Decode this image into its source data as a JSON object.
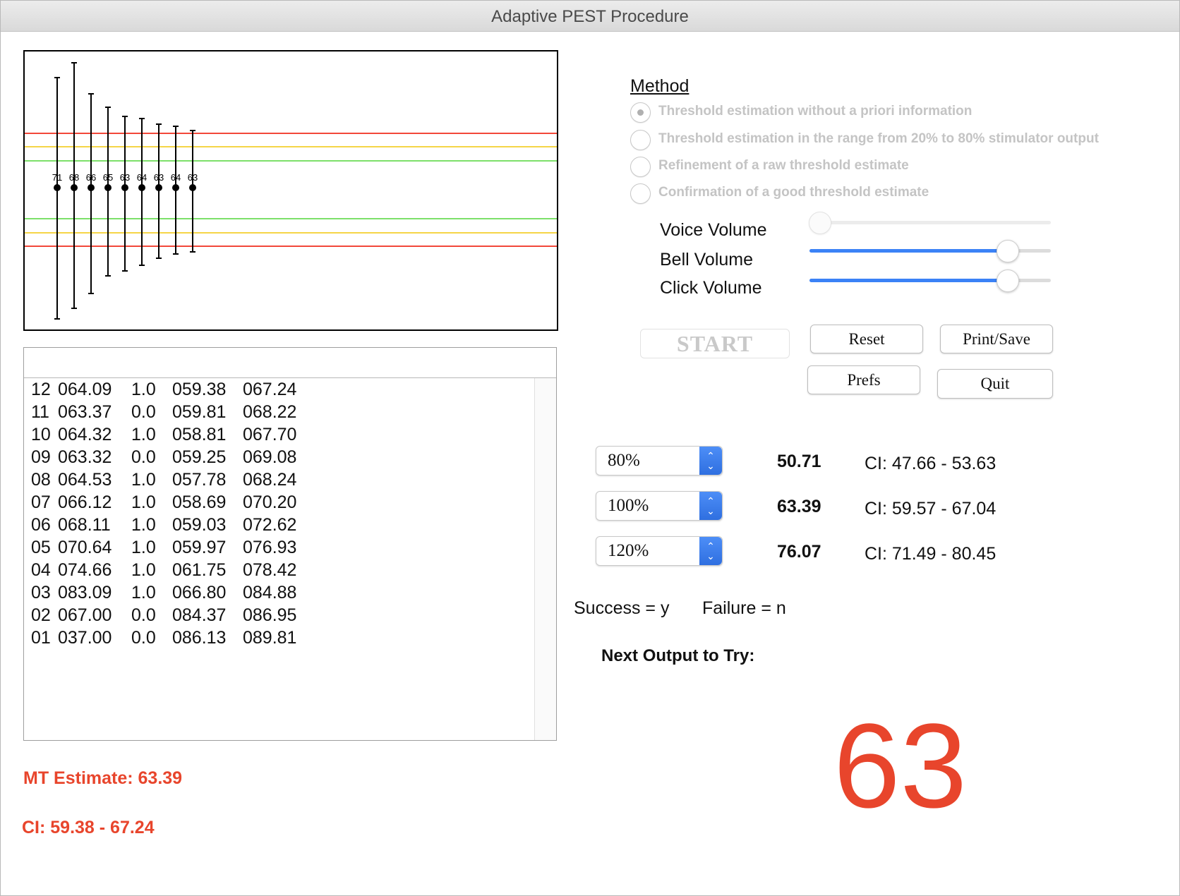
{
  "window": {
    "title": "Adaptive PEST Procedure"
  },
  "plot": {
    "center_labels": [
      "71",
      "68",
      "66",
      "65",
      "63",
      "64",
      "63",
      "64",
      "63"
    ],
    "line_colors": {
      "outer": "#f2483a",
      "middle": "#f5d547",
      "inner": "#7de06a"
    }
  },
  "log": {
    "rows": [
      [
        "12",
        "064.09",
        "1.0",
        "059.38",
        "067.24"
      ],
      [
        "11",
        "063.37",
        "0.0",
        "059.81",
        "068.22"
      ],
      [
        "10",
        "064.32",
        "1.0",
        "058.81",
        "067.70"
      ],
      [
        "09",
        "063.32",
        "0.0",
        "059.25",
        "069.08"
      ],
      [
        "08",
        "064.53",
        "1.0",
        "057.78",
        "068.24"
      ],
      [
        "07",
        "066.12",
        "1.0",
        "058.69",
        "070.20"
      ],
      [
        "06",
        "068.11",
        "1.0",
        "059.03",
        "072.62"
      ],
      [
        "05",
        "070.64",
        "1.0",
        "059.97",
        "076.93"
      ],
      [
        "04",
        "074.66",
        "1.0",
        "061.75",
        "078.42"
      ],
      [
        "03",
        "083.09",
        "1.0",
        "066.80",
        "084.88"
      ],
      [
        "02",
        "067.00",
        "0.0",
        "084.37",
        "086.95"
      ],
      [
        "01",
        "037.00",
        "0.0",
        "086.13",
        "089.81"
      ]
    ]
  },
  "estimate": {
    "mt": "MT Estimate: 63.39",
    "ci": "CI: 59.38 - 67.24"
  },
  "method": {
    "title": "Method",
    "options": [
      "Threshold estimation without a priori information",
      "Threshold estimation in the range from 20% to 80% stimulator output",
      "Refinement of a raw threshold estimate",
      "Confirmation of a good threshold estimate"
    ]
  },
  "volumes": [
    {
      "label": "Voice Volume",
      "level": 0.04
    },
    {
      "label": "Bell Volume",
      "level": 0.82
    },
    {
      "label": "Click Volume",
      "level": 0.82
    }
  ],
  "buttons": {
    "start": "START",
    "reset": "Reset",
    "print_save": "Print/Save",
    "prefs": "Prefs",
    "quit": "Quit"
  },
  "results": [
    {
      "percent": "80%",
      "value": "50.71",
      "ci": "CI: 47.66 - 53.63"
    },
    {
      "percent": "100%",
      "value": "63.39",
      "ci": "CI: 59.57 - 67.04"
    },
    {
      "percent": "120%",
      "value": "76.07",
      "ci": "CI: 71.49 - 80.45"
    }
  ],
  "legend": {
    "success": "Success = y",
    "failure": "Failure = n"
  },
  "next": {
    "label": "Next Output to Try:",
    "value": "63"
  }
}
